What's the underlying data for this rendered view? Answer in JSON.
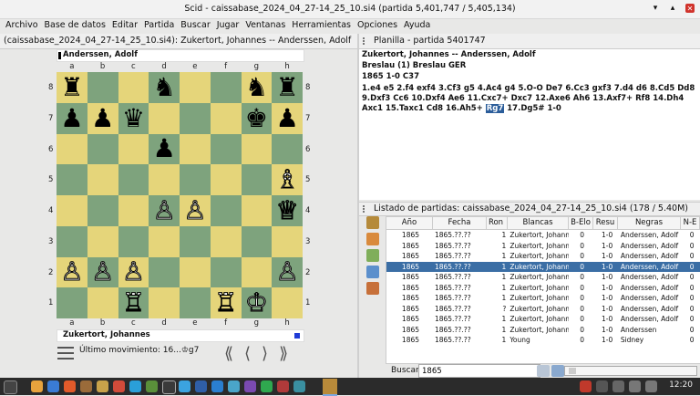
{
  "window": {
    "title": "Scid - caissabase_2024_04_27-14_25_10.si4 (partida 5,401,747 / 5,405,134)"
  },
  "menu": [
    "Archivo",
    "Base de datos",
    "Editar",
    "Partida",
    "Buscar",
    "Jugar",
    "Ventanas",
    "Herramientas",
    "Opciones",
    "Ayuda"
  ],
  "left_pane": {
    "title": "(caissabase_2024_04_27-14_25_10.si4): Zukertort, Johannes -- Anderssen, Adolf"
  },
  "board": {
    "top_player": "Anderssen, Adolf",
    "bottom_player": "Zukertort, Johannes",
    "files": [
      "a",
      "b",
      "c",
      "d",
      "e",
      "f",
      "g",
      "h"
    ],
    "ranks": [
      "8",
      "7",
      "6",
      "5",
      "4",
      "3",
      "2",
      "1"
    ],
    "position": [
      [
        "bR",
        "",
        "",
        "bN",
        "",
        "",
        "bN",
        "bR"
      ],
      [
        "bP",
        "bP",
        "bQ",
        "",
        "",
        "",
        "bK",
        "bP"
      ],
      [
        "",
        "",
        "",
        "bP",
        "",
        "",
        "",
        ""
      ],
      [
        "",
        "",
        "",
        "",
        "",
        "",
        "",
        "wB"
      ],
      [
        "",
        "",
        "",
        "wP",
        "wP",
        "",
        "",
        "wQ"
      ],
      [
        "",
        "",
        "",
        "",
        "",
        "",
        "",
        ""
      ],
      [
        "wP",
        "wP",
        "wP",
        "",
        "",
        "",
        "",
        "wP"
      ],
      [
        "",
        "",
        "wR",
        "",
        "",
        "wR",
        "wK",
        ""
      ]
    ],
    "last_move_label": "Último movimiento: 16...♔g7",
    "nav": [
      "⟪",
      "⟨",
      "⟩",
      "⟫"
    ]
  },
  "notation": {
    "pane_title": "Planilla - partida 5401747",
    "header": [
      "Zukertort, Johannes  --  Anderssen, Adolf",
      "Breslau (1)  Breslau GER",
      "1865  1-0  C37"
    ],
    "moves_before": "1.e4 e5 2.f4 exf4 3.Cf3 g5 4.Ac4 g4 5.O-O De7 6.Cc3 gxf3 7.d4 d6 8.Cd5 Dd8 9.Dxf3 Cc6 10.Dxf4 Ae6 11.Cxc7+ Dxc7 12.Axe6 Ah6 13.Axf7+ Rf8 14.Dh4 Axc1 15.Taxc1 Cd8 16.Ah5+ ",
    "moves_current": "Rg7",
    "moves_after": " 17.Dg5# 1-0"
  },
  "game_list": {
    "pane_title": "Listado de partidas: caissabase_2024_04_27-14_25_10.si4 (178 / 5.40M)",
    "columns": [
      "Año",
      "Fecha",
      "Ron",
      "Blancas",
      "B-Elo",
      "Resu",
      "Negras",
      "N-E"
    ],
    "rows": [
      [
        "1865",
        "1865.??.??",
        "1",
        "Zukertort, Johanne",
        "0",
        "1-0",
        "Anderssen, Adolf",
        "0"
      ],
      [
        "1865",
        "1865.??.??",
        "1",
        "Zukertort, Johanne",
        "0",
        "1-0",
        "Anderssen, Adolf",
        "0"
      ],
      [
        "1865",
        "1865.??.??",
        "1",
        "Zukertort, Johanne",
        "0",
        "1-0",
        "Anderssen, Adolf",
        "0"
      ],
      [
        "1865",
        "1865.??.??",
        "1",
        "Zukertort, Johanne",
        "0",
        "1-0",
        "Anderssen, Adolf",
        "0"
      ],
      [
        "1865",
        "1865.??.??",
        "1",
        "Zukertort, Johanne",
        "0",
        "1-0",
        "Anderssen, Adolf",
        "0"
      ],
      [
        "1865",
        "1865.??.??",
        "1",
        "Zukertort, Johanne",
        "0",
        "1-0",
        "Anderssen, Adolf",
        "0"
      ],
      [
        "1865",
        "1865.??.??",
        "1",
        "Zukertort, Johanne",
        "0",
        "1-0",
        "Anderssen, Adolf",
        "0"
      ],
      [
        "1865",
        "1865.??.??",
        "?",
        "Zukertort, Johanne",
        "0",
        "1-0",
        "Anderssen, Adolf",
        "0"
      ],
      [
        "1865",
        "1865.??.??",
        "1",
        "Zukertort, Johanne",
        "0",
        "1-0",
        "Anderssen, Adolf",
        "0"
      ],
      [
        "1865",
        "1865.??.??",
        "1",
        "Zukertort, Johanne",
        "0",
        "1-0",
        "Anderssen",
        "0"
      ],
      [
        "1865",
        "1865.??.??",
        "1",
        "Young",
        "0",
        "1-0",
        "Sidney",
        "0"
      ]
    ],
    "selected_index": 3,
    "search_label": "Buscar",
    "search_value": "1865"
  },
  "taskbar": {
    "clock": "12:20"
  }
}
